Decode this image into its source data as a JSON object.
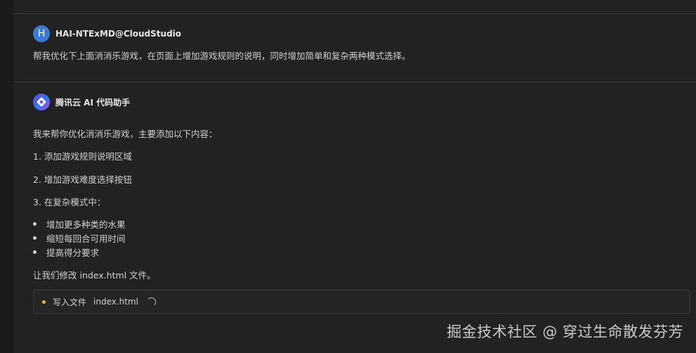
{
  "user_message": {
    "avatar_letter": "H",
    "username": "HAI-NTExMD@CloudStudio",
    "text": "帮我优化下上面消消乐游戏，在页面上增加游戏规则的说明，同时增加简单和复杂两种模式选择。"
  },
  "assistant_message": {
    "name": "腾讯云 AI 代码助手",
    "intro": "我来帮你优化消消乐游戏，主要添加以下内容：",
    "steps": [
      "1. 添加游戏规则说明区域",
      "2. 增加游戏难度选择按钮",
      "3. 在复杂模式中："
    ],
    "bullets": [
      "增加更多种类的水果",
      "缩短每回合可用时间",
      "提高得分要求"
    ],
    "closing": "让我们修改 index.html 文件。",
    "file_action": {
      "label": "写入文件",
      "filename": "index.html",
      "status_icon": "loading-spinner-icon"
    }
  },
  "watermark": "掘金技术社区 @ 穿过生命散发芬芳",
  "colors": {
    "background": "#222223",
    "user_avatar": "#3a7bd5",
    "file_status_dot": "#e2b93d"
  }
}
